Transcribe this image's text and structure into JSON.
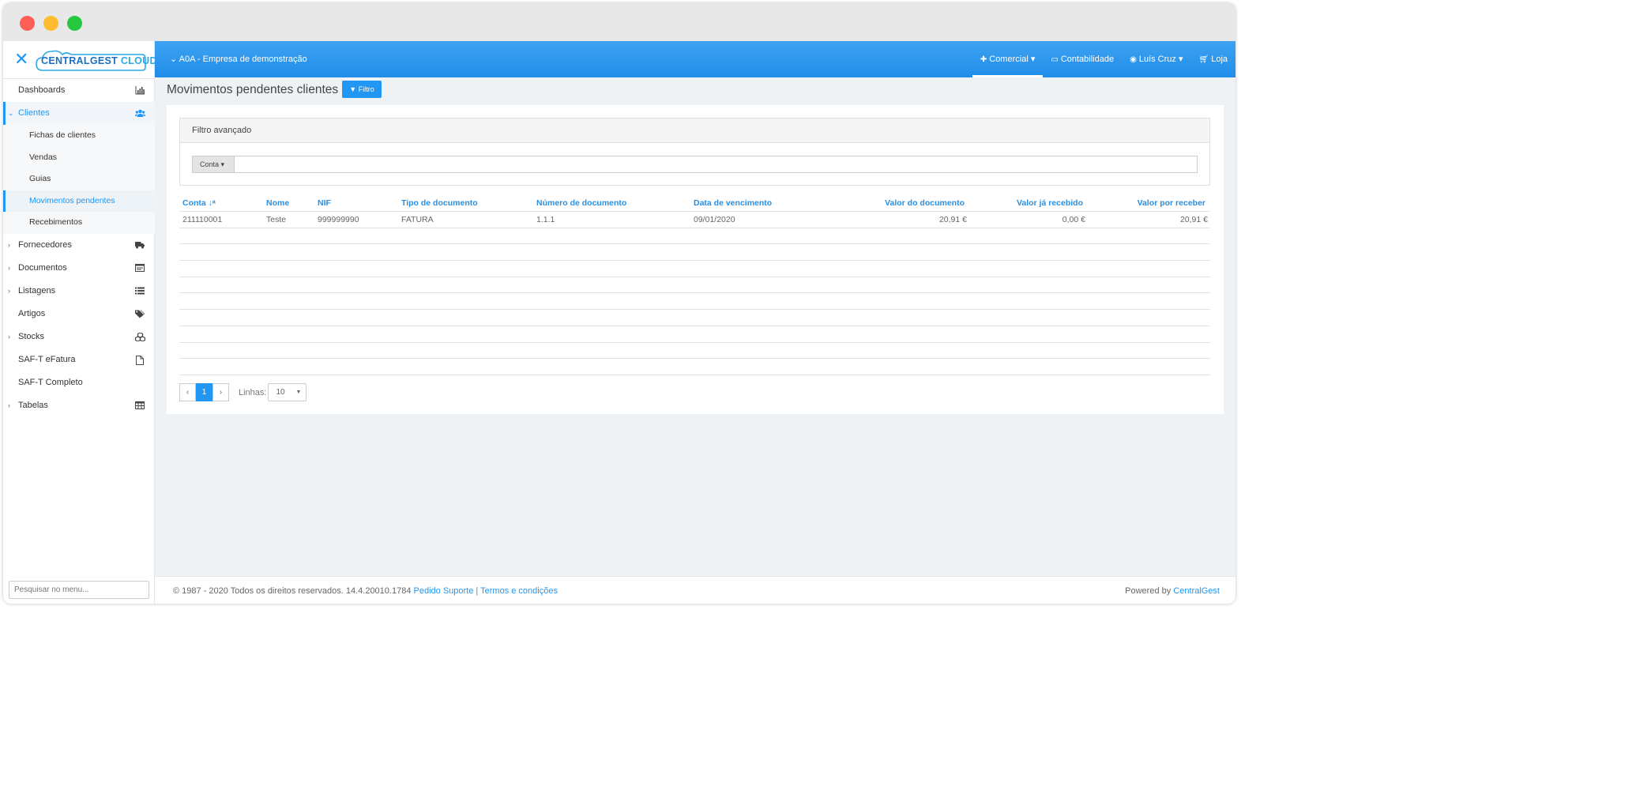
{
  "company": "A0A - Empresa de demonstração",
  "logo": {
    "part1": "CENTRALGEST",
    "part2": "CLOUD"
  },
  "topnav": [
    {
      "label": "Comercial",
      "icon": "puzzle-icon"
    },
    {
      "label": "Contabilidade",
      "icon": "window-icon"
    },
    {
      "label": "Luís Cruz",
      "icon": "user-circle-icon"
    },
    {
      "label": "Loja",
      "icon": "cart-icon"
    }
  ],
  "sidebar": {
    "items": [
      {
        "label": "Dashboards",
        "icon": "bar-chart-icon"
      },
      {
        "label": "Clientes",
        "icon": "users-icon"
      },
      {
        "label": "Fornecedores",
        "icon": "truck-icon"
      },
      {
        "label": "Documentos",
        "icon": "document-icon"
      },
      {
        "label": "Listagens",
        "icon": "list-icon"
      },
      {
        "label": "Artigos",
        "icon": "tags-icon"
      },
      {
        "label": "Stocks",
        "icon": "cubes-icon"
      },
      {
        "label": "SAF-T eFatura",
        "icon": "file-icon"
      },
      {
        "label": "SAF-T Completo",
        "icon": ""
      },
      {
        "label": "Tabelas",
        "icon": "table-icon"
      }
    ],
    "clientes_sub": [
      "Fichas de clientes",
      "Vendas",
      "Guias",
      "Movimentos pendentes",
      "Recebimentos"
    ],
    "search_placeholder": "Pesquisar no menu..."
  },
  "page": {
    "title": "Movimentos pendentes clientes",
    "filter_button": "Filtro",
    "panel_title": "Filtro avançado",
    "conta_label": "Conta"
  },
  "table": {
    "headers": [
      "Conta",
      "Nome",
      "NIF",
      "Tipo de documento",
      "Número de documento",
      "Data de vencimento",
      "Valor do documento",
      "Valor já recebido",
      "Valor por receber"
    ],
    "rows": [
      [
        "211110001",
        "Teste",
        "999999990",
        "FATURA",
        "1.1.1",
        "09/01/2020",
        "20,91 €",
        "0,00 €",
        "20,91 €"
      ]
    ]
  },
  "pager": {
    "current": "1",
    "lines_label": "Linhas:",
    "lines_value": "10",
    "prev": "‹",
    "next": "›"
  },
  "footer": {
    "copyright": "© 1987 - 2020 Todos os direitos reservados. 14.4.20010.1784",
    "support": "Pedido Suporte",
    "sep": "|",
    "terms": "Termos e condições",
    "powered": "Powered by",
    "brand": "CentralGest"
  },
  "colors": {
    "accent": "#2196f3",
    "topbar": "#2a95ec"
  }
}
